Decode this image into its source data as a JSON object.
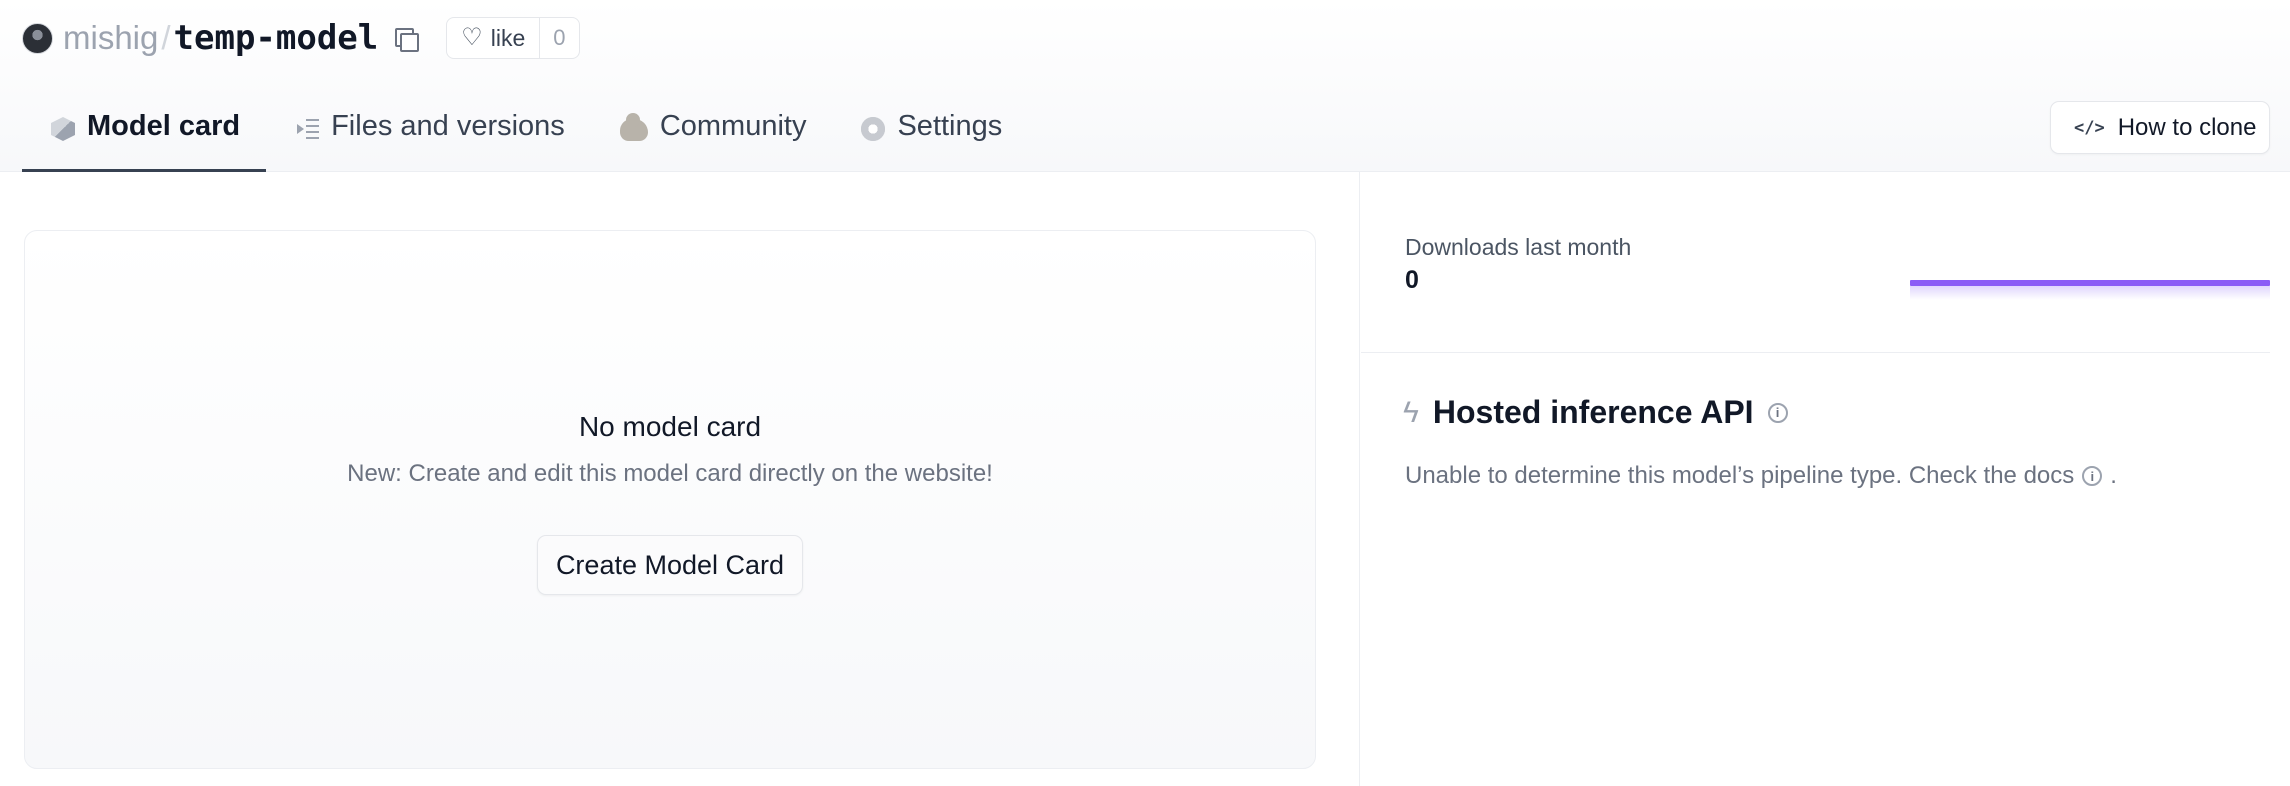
{
  "header": {
    "owner": "mishig",
    "separator": "/",
    "repo": "temp-model",
    "like_label": "like",
    "like_count": "0"
  },
  "tabs": [
    {
      "label": "Model card",
      "icon": "cube-icon",
      "active": true
    },
    {
      "label": "Files and versions",
      "icon": "files-icon",
      "active": false
    },
    {
      "label": "Community",
      "icon": "community-icon",
      "active": false
    },
    {
      "label": "Settings",
      "icon": "gear-icon",
      "active": false
    }
  ],
  "clone_button": {
    "label": "How to clone",
    "icon": "code-icon"
  },
  "model_card": {
    "title": "No model card",
    "subtitle": "New: Create and edit this model card directly on the website!",
    "button_label": "Create Model Card"
  },
  "sidebar": {
    "downloads_label": "Downloads last month",
    "downloads_value": "0",
    "downloads_chart_color": "#8b5cf6",
    "inference_title": "Hosted inference API",
    "inference_text": "Unable to determine this model’s pipeline type. Check the docs",
    "inference_text_end": "."
  },
  "colors": {
    "accent": "#8b5cf6",
    "text_primary": "#111827",
    "text_muted": "#6b7280"
  }
}
